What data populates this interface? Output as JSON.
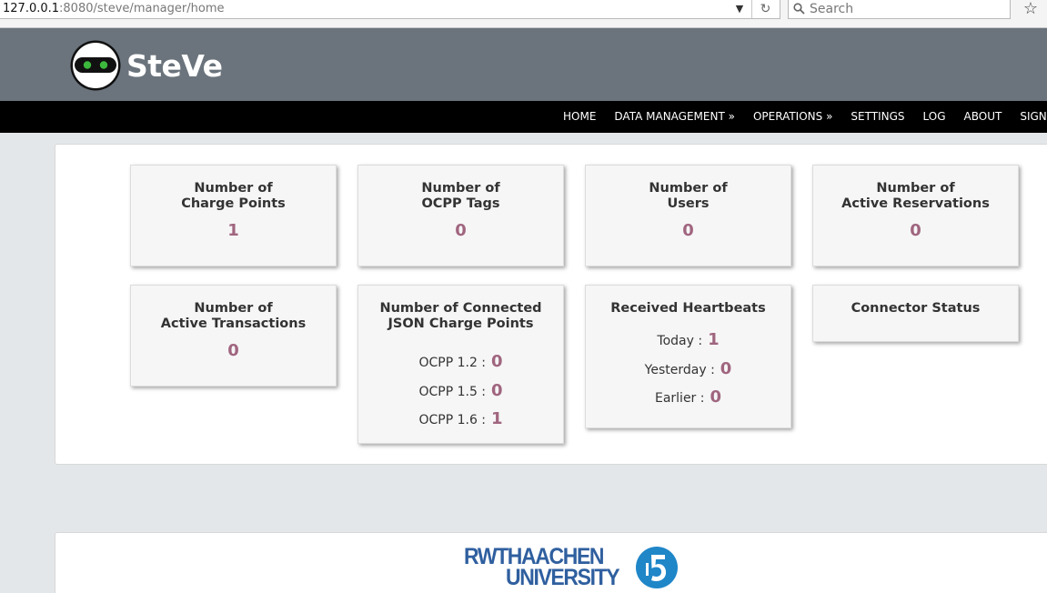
{
  "browser": {
    "url_host": "127.0.0.1",
    "url_rest": ":8080/steve/manager/home",
    "search_placeholder": "Search"
  },
  "header": {
    "brand": "SteVe"
  },
  "nav": {
    "items": [
      "HOME",
      "DATA MANAGEMENT »",
      "OPERATIONS »",
      "SETTINGS",
      "LOG",
      "ABOUT",
      "SIGN OUT"
    ]
  },
  "tiles": {
    "charge_points": {
      "title": "Number of\nCharge Points",
      "value": "1"
    },
    "ocpp_tags": {
      "title": "Number of\nOCPP Tags",
      "value": "0"
    },
    "users": {
      "title": "Number of\nUsers",
      "value": "0"
    },
    "reservations": {
      "title": "Number of\nActive Reservations",
      "value": "0"
    },
    "transactions": {
      "title": "Number of\nActive Transactions",
      "value": "0"
    },
    "connected_json": {
      "title": "Number of Connected\nJSON Charge Points",
      "rows": [
        {
          "label": "OCPP 1.2 :",
          "value": "0"
        },
        {
          "label": "OCPP 1.5 :",
          "value": "0"
        },
        {
          "label": "OCPP 1.6 :",
          "value": "1"
        }
      ]
    },
    "heartbeats": {
      "title": "Received Heartbeats",
      "rows": [
        {
          "label": "Today :",
          "value": "1"
        },
        {
          "label": "Yesterday :",
          "value": "0"
        },
        {
          "label": "Earlier :",
          "value": "0"
        }
      ]
    },
    "connector_status": {
      "title": "Connector Status"
    }
  },
  "footer": {
    "logo_line1": "RWTHAACHEN",
    "logo_line2": "UNIVERSITY"
  },
  "colors": {
    "header_bg": "#6b747d",
    "navbar_bg": "#000000",
    "value_accent": "#a0657f",
    "rwth_blue": "#2f5f9f"
  }
}
